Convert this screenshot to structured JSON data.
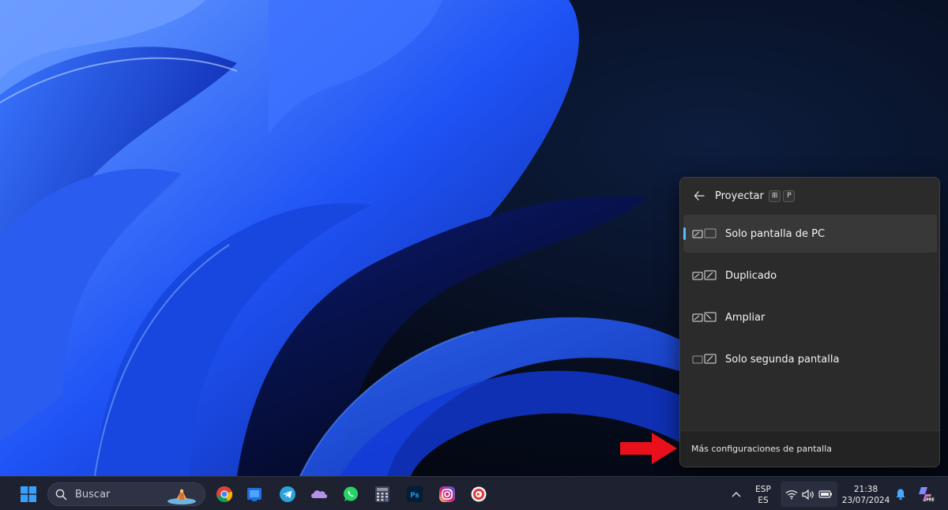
{
  "project_panel": {
    "title": "Proyectar",
    "shortcut_keys": [
      "⊞",
      "P"
    ],
    "options": [
      {
        "label": "Solo pantalla de PC",
        "icon": "pc-screen-only-icon",
        "selected": true
      },
      {
        "label": "Duplicado",
        "icon": "duplicate-icon",
        "selected": false
      },
      {
        "label": "Ampliar",
        "icon": "extend-icon",
        "selected": false
      },
      {
        "label": "Solo segunda pantalla",
        "icon": "second-screen-only-icon",
        "selected": false
      }
    ],
    "footer_link": "Más configuraciones de pantalla"
  },
  "taskbar": {
    "search_placeholder": "Buscar",
    "apps": [
      "chrome-icon",
      "taskview-icon",
      "telegram-icon",
      "onedrive-icon",
      "whatsapp-icon",
      "calculator-icon",
      "photoshop-icon",
      "instagram-icon",
      "app-icon"
    ],
    "language_line1": "ESP",
    "language_line2": "ES",
    "time": "21:38",
    "date": "23/07/2024",
    "copilot_badge": "PRE"
  },
  "colors": {
    "accent": "#4cc2ff",
    "panel_bg": "#2b2b2b",
    "arrow": "#e8111b",
    "taskbar_bg": "#1e2230"
  }
}
